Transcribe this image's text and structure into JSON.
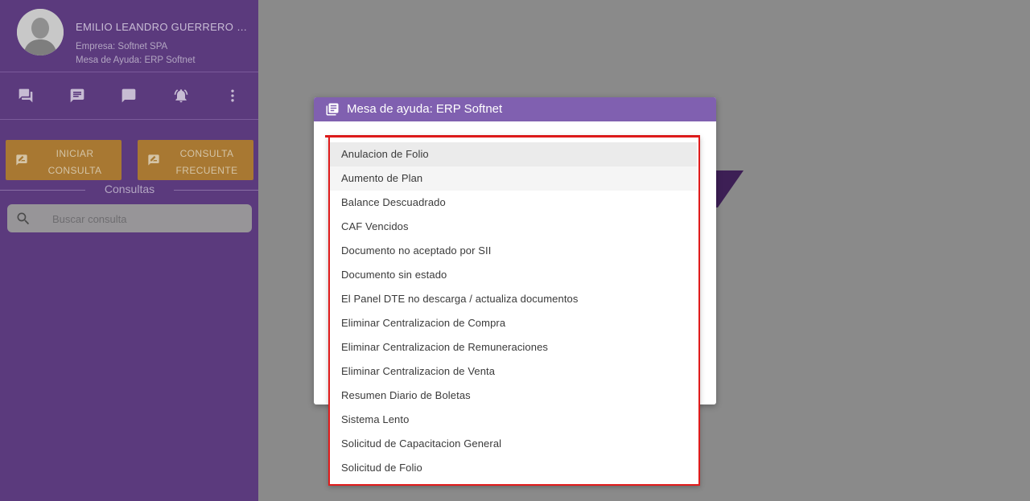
{
  "sidebar": {
    "user": {
      "name": "EMILIO LEANDRO GUERRERO CALDERON",
      "company": "Empresa: Softnet SPA",
      "desk": "Mesa de Ayuda: ERP Softnet"
    },
    "icons": [
      "forum-icon",
      "chat-icon",
      "message-icon",
      "alarm-icon",
      "more-vert-icon"
    ],
    "buttons": {
      "iniciar": "INICIAR CONSULTA",
      "frecuente": "CONSULTA FRECUENTE"
    },
    "consultas_title": "Consultas",
    "search": {
      "placeholder": "Buscar consulta"
    }
  },
  "modal": {
    "title": "Mesa de ayuda: ERP Softnet"
  },
  "dropdown": {
    "options": [
      "Anulacion de Folio",
      "Aumento de Plan",
      "Balance Descuadrado",
      "CAF Vencidos",
      "Documento no aceptado por SII",
      "Documento sin estado",
      "El Panel DTE no descarga / actualiza documentos",
      "Eliminar Centralizacion de Compra",
      "Eliminar Centralizacion de Remuneraciones",
      "Eliminar Centralizacion de Venta",
      "Resumen Diario de Boletas",
      "Sistema Lento",
      "Solicitud de Capacitacion General",
      "Solicitud de Folio"
    ]
  },
  "colors": {
    "sidebar": "#5b3a7d",
    "modal_header": "#8060b0",
    "button": "#a87832",
    "highlight_border": "#e01b1b"
  }
}
